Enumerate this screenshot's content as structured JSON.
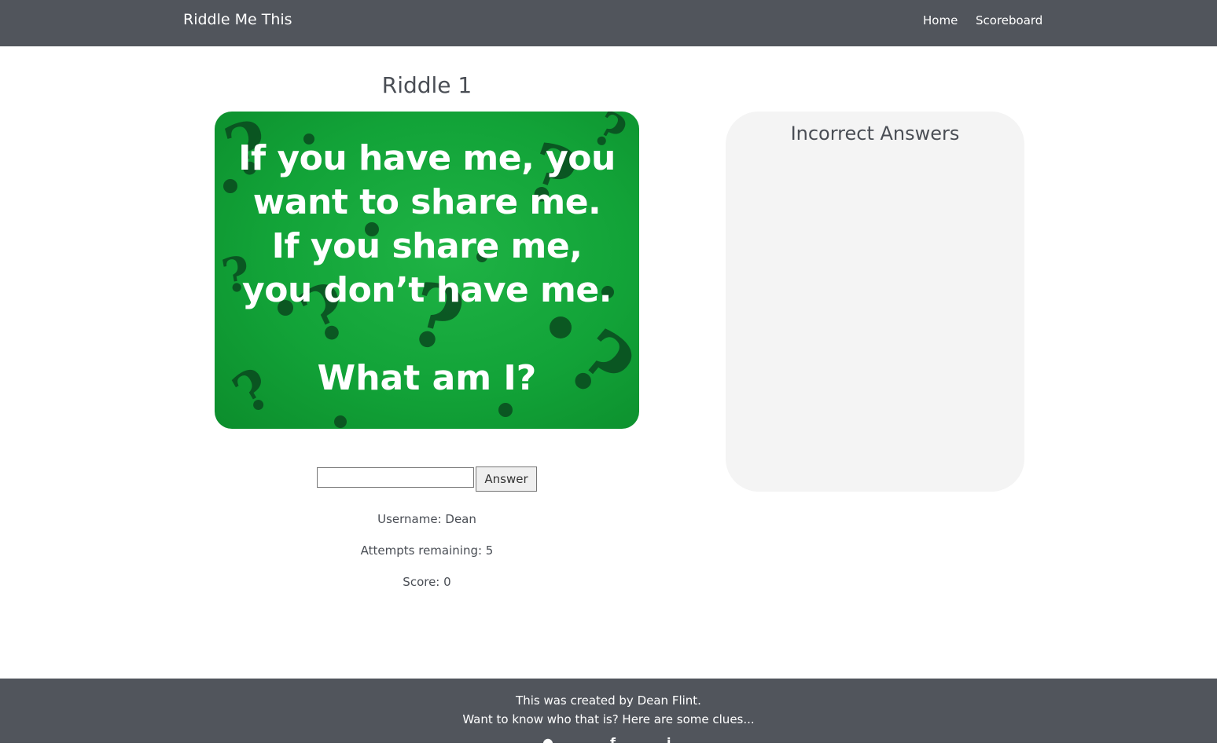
{
  "navbar": {
    "brand": "Riddle Me This",
    "links": [
      {
        "label": "Home"
      },
      {
        "label": "Scoreboard"
      }
    ]
  },
  "riddle": {
    "title": "Riddle 1",
    "image_text": "If you have me, you want to share me. If you share me, you don’t have me.",
    "image_question": "What am I?",
    "image_colors": {
      "background": "#12a338",
      "marks": "#0a4a1f",
      "text": "#ffffff"
    }
  },
  "answer_form": {
    "input_value": "",
    "button_label": "Answer"
  },
  "stats": {
    "username": "Username: Dean",
    "attempts": "Attempts remaining: 5",
    "score": "Score: 0"
  },
  "incorrect_panel": {
    "title": "Incorrect Answers",
    "items": []
  },
  "footer": {
    "line1": "This was created by Dean Flint.",
    "line2": "Want to know who that is? Here are some clues...",
    "icons": [
      "github-icon",
      "facebook-icon",
      "linkedin-icon"
    ]
  },
  "colors": {
    "nav_bg": "#51555c",
    "panel_bg": "#f4f4f4",
    "text": "#4a4e55"
  }
}
